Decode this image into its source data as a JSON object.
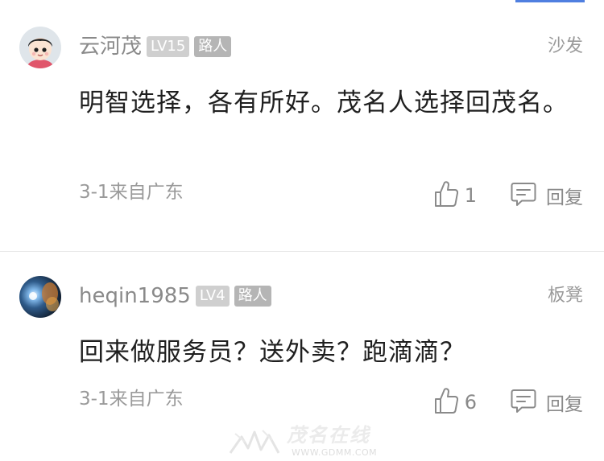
{
  "comments": [
    {
      "username": "云河茂",
      "level": "LV15",
      "role": "路人",
      "floor": "沙发",
      "text": "明智选择，各有所好。茂名人选择回茂名。",
      "time": "3-1来自广东",
      "likes": "1",
      "reply_label": "回复"
    },
    {
      "username": "heqin1985",
      "level": "LV4",
      "role": "路人",
      "floor": "板凳",
      "text": "回来做服务员？送外卖？跑滴滴？",
      "time": "3-1来自广东",
      "likes": "6",
      "reply_label": "回复"
    }
  ],
  "watermark": {
    "brand": "茂名在线",
    "url": "WWW.GDMM.COM"
  },
  "colors": {
    "accent": "#4f7fe0",
    "muted_text": "#8a8a8a",
    "badge_bg": "#cfcfcf"
  }
}
